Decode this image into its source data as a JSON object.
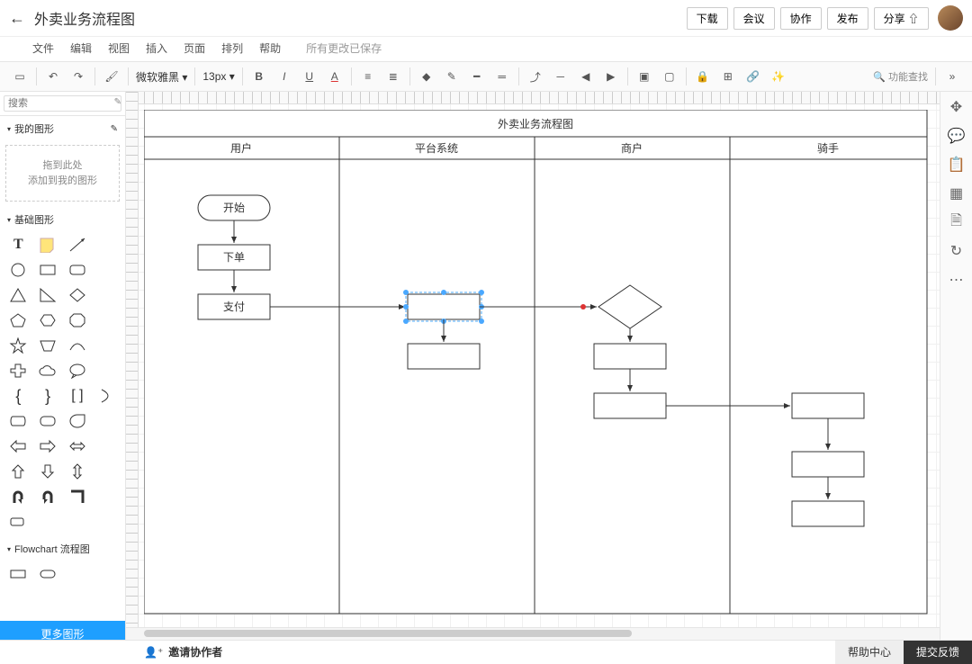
{
  "title": "外卖业务流程图",
  "menus": {
    "file": "文件",
    "edit": "编辑",
    "view": "视图",
    "insert": "插入",
    "page": "页面",
    "arrange": "排列",
    "help": "帮助"
  },
  "save_status": "所有更改已保存",
  "header_buttons": {
    "download": "下载",
    "meeting": "会议",
    "collab": "协作",
    "publish": "发布",
    "share": "分享 ⇧"
  },
  "toolbar": {
    "font": "微软雅黑",
    "size": "13px",
    "search_label": "功能查找"
  },
  "sidebar": {
    "search_placeholder": "搜索",
    "group_myshapes": "我的图形",
    "dropzone_l1": "拖到此处",
    "dropzone_l2": "添加到我的图形",
    "group_basic": "基础图形",
    "group_flowchart": "Flowchart 流程图",
    "more_shapes": "更多图形"
  },
  "diagram": {
    "title": "外卖业务流程图",
    "lanes": {
      "user": "用户",
      "platform": "平台系统",
      "merchant": "商户",
      "rider": "骑手"
    },
    "nodes": {
      "start": "开始",
      "order": "下单",
      "pay": "支付"
    }
  },
  "footer": {
    "invite": "邀请协作者",
    "help_center": "帮助中心",
    "feedback": "提交反馈"
  }
}
